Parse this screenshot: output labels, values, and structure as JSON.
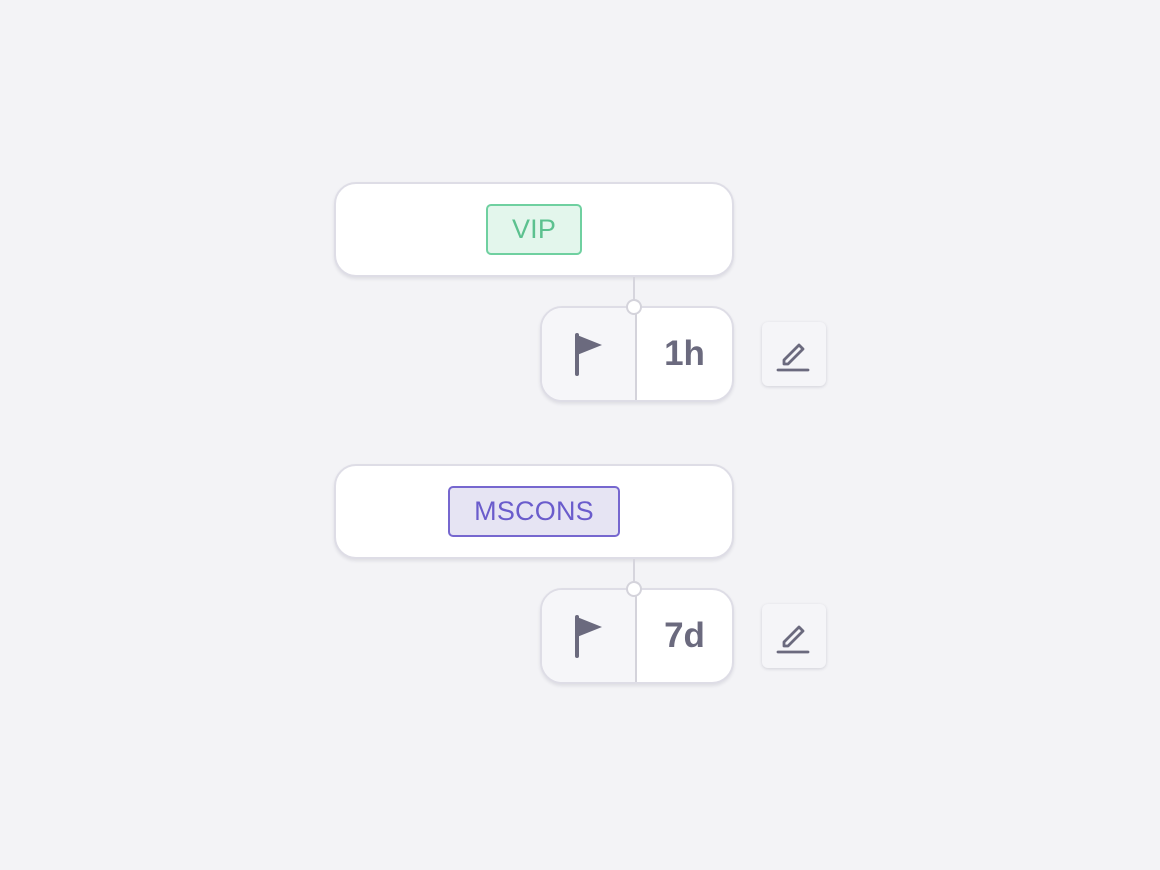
{
  "rules": [
    {
      "tag": {
        "label": "VIP",
        "text_color": "#5cc18f",
        "bg_color": "#e3f6ec",
        "border_color": "#6fd0a0"
      },
      "sla": {
        "flag_icon": "flag-icon",
        "time": "1h"
      },
      "edit_icon": "pencil-icon"
    },
    {
      "tag": {
        "label": "MSCONS",
        "text_color": "#6a5ccc",
        "bg_color": "#e6e4f3",
        "border_color": "#7667cf"
      },
      "sla": {
        "flag_icon": "flag-icon",
        "time": "7d"
      },
      "edit_icon": "pencil-icon"
    }
  ],
  "colors": {
    "background": "#f3f3f6",
    "card_border": "#dedde6",
    "icon": "#6b6a7e",
    "connector": "#d4d3db"
  }
}
